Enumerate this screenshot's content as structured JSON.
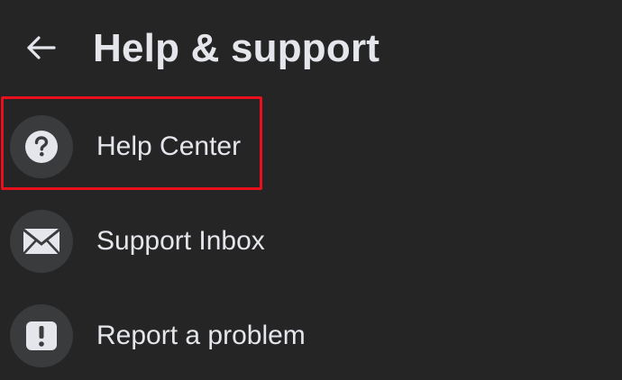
{
  "header": {
    "back_icon": "arrow-left-icon",
    "title": "Help & support"
  },
  "menu": {
    "items": [
      {
        "label": "Help Center",
        "icon": "question-circle-icon"
      },
      {
        "label": "Support Inbox",
        "icon": "envelope-icon"
      },
      {
        "label": "Report a problem",
        "icon": "exclamation-icon"
      }
    ]
  },
  "highlight": {
    "target": "Help Center",
    "color": "#e8101c"
  },
  "colors": {
    "background": "#252526",
    "icon_circle": "#3a3b3c",
    "text": "#e4e6eb"
  }
}
